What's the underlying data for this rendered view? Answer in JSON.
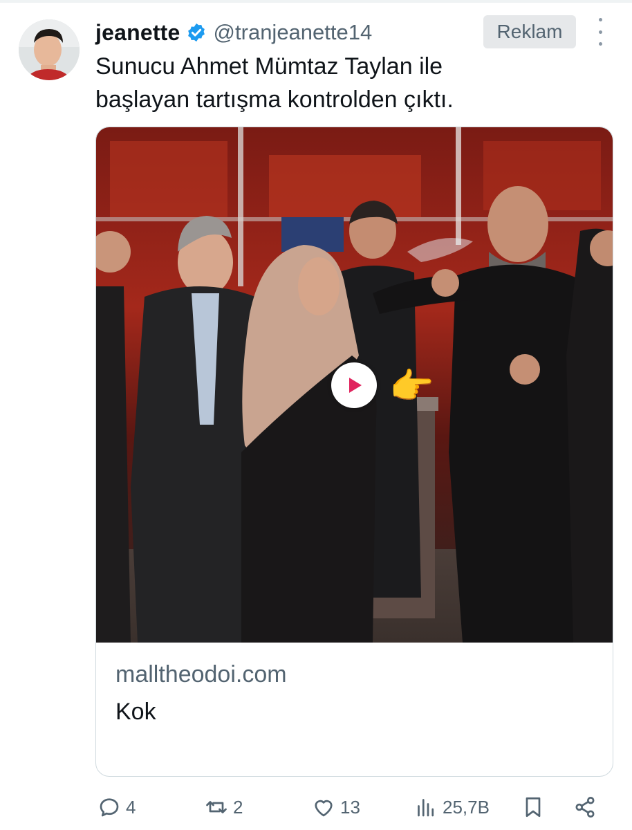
{
  "author": {
    "name": "jeanette",
    "handle": "@tranjeanette14",
    "verified": true
  },
  "ad_badge": "Reklam",
  "tweet_text_lines": [
    "Sunucu Ahmet Mümtaz Taylan ile",
    "başlayan tartışma kontrolden çıktı."
  ],
  "card": {
    "domain": "malltheodoi.com",
    "title": "Kok",
    "media_icon": "play-icon",
    "pointer_emoji": "👉"
  },
  "actions": {
    "replies": "4",
    "retweets": "2",
    "likes": "13",
    "views": "25,7B"
  },
  "colors": {
    "verified": "#1d9bf0",
    "secondary_text": "#536471",
    "play_icon": "#e0245e"
  }
}
